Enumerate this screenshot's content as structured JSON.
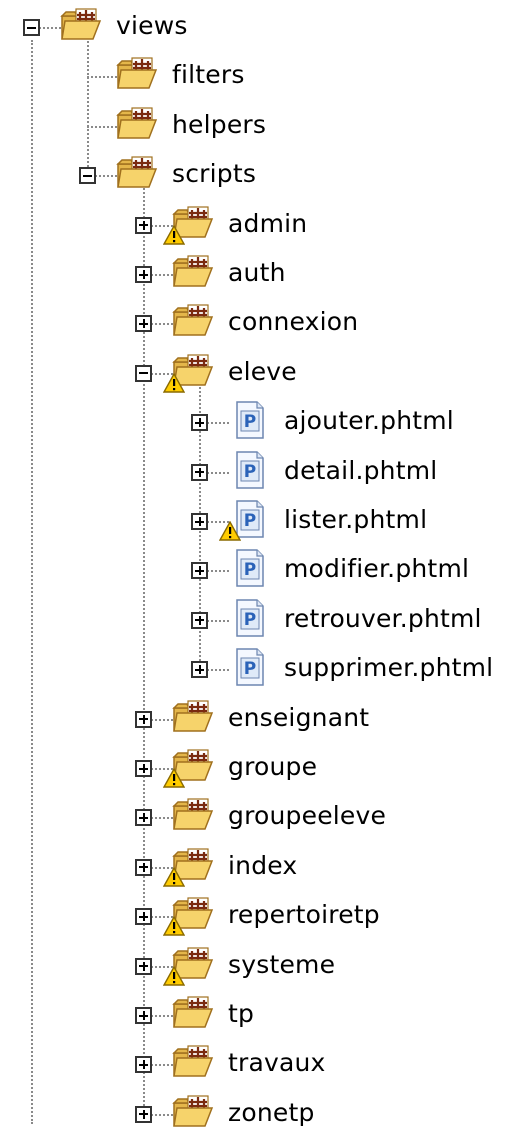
{
  "tree": {
    "nodes": [
      {
        "id": "views",
        "label": "views",
        "level": 0,
        "expanded": true,
        "expander": true,
        "icon": "folder-open-icon",
        "warning": false
      },
      {
        "id": "filters",
        "label": "filters",
        "level": 1,
        "expander": false,
        "icon": "folder-open-icon",
        "warning": false
      },
      {
        "id": "helpers",
        "label": "helpers",
        "level": 1,
        "expander": false,
        "icon": "folder-open-icon",
        "warning": false
      },
      {
        "id": "scripts",
        "label": "scripts",
        "level": 1,
        "expanded": true,
        "expander": true,
        "icon": "folder-open-icon",
        "warning": false
      },
      {
        "id": "admin",
        "label": "admin",
        "level": 2,
        "expanded": false,
        "expander": true,
        "icon": "folder-open-icon",
        "warning": true
      },
      {
        "id": "auth",
        "label": "auth",
        "level": 2,
        "expanded": false,
        "expander": true,
        "icon": "folder-open-icon",
        "warning": false
      },
      {
        "id": "connexion",
        "label": "connexion",
        "level": 2,
        "expanded": false,
        "expander": true,
        "icon": "folder-open-icon",
        "warning": false
      },
      {
        "id": "eleve",
        "label": "eleve",
        "level": 2,
        "expanded": true,
        "expander": true,
        "icon": "folder-open-icon",
        "warning": true
      },
      {
        "id": "ajouter",
        "label": "ajouter.phtml",
        "level": 3,
        "expanded": false,
        "expander": true,
        "icon": "php-file-icon",
        "warning": false
      },
      {
        "id": "detail",
        "label": "detail.phtml",
        "level": 3,
        "expanded": false,
        "expander": true,
        "icon": "php-file-icon",
        "warning": false
      },
      {
        "id": "lister",
        "label": "lister.phtml",
        "level": 3,
        "expanded": false,
        "expander": true,
        "icon": "php-file-icon",
        "warning": true
      },
      {
        "id": "modifier",
        "label": "modifier.phtml",
        "level": 3,
        "expanded": false,
        "expander": true,
        "icon": "php-file-icon",
        "warning": false
      },
      {
        "id": "retrouver",
        "label": "retrouver.phtml",
        "level": 3,
        "expanded": false,
        "expander": true,
        "icon": "php-file-icon",
        "warning": false
      },
      {
        "id": "supprimer",
        "label": "supprimer.phtml",
        "level": 3,
        "expanded": false,
        "expander": true,
        "icon": "php-file-icon",
        "warning": false
      },
      {
        "id": "enseignant",
        "label": "enseignant",
        "level": 2,
        "expanded": false,
        "expander": true,
        "icon": "folder-open-icon",
        "warning": false
      },
      {
        "id": "groupe",
        "label": "groupe",
        "level": 2,
        "expanded": false,
        "expander": true,
        "icon": "folder-open-icon",
        "warning": true
      },
      {
        "id": "groupeeleve",
        "label": "groupeeleve",
        "level": 2,
        "expanded": false,
        "expander": true,
        "icon": "folder-open-icon",
        "warning": false
      },
      {
        "id": "index",
        "label": "index",
        "level": 2,
        "expanded": false,
        "expander": true,
        "icon": "folder-open-icon",
        "warning": true
      },
      {
        "id": "repertoiretp",
        "label": "repertoiretp",
        "level": 2,
        "expanded": false,
        "expander": true,
        "icon": "folder-open-icon",
        "warning": true
      },
      {
        "id": "systeme",
        "label": "systeme",
        "level": 2,
        "expanded": false,
        "expander": true,
        "icon": "folder-open-icon",
        "warning": true
      },
      {
        "id": "tp",
        "label": "tp",
        "level": 2,
        "expanded": false,
        "expander": true,
        "icon": "folder-open-icon",
        "warning": false
      },
      {
        "id": "travaux",
        "label": "travaux",
        "level": 2,
        "expanded": false,
        "expander": true,
        "icon": "folder-open-icon",
        "warning": false
      },
      {
        "id": "zonetp",
        "label": "zonetp",
        "level": 2,
        "expanded": false,
        "expander": true,
        "icon": "folder-open-icon",
        "warning": false
      }
    ]
  },
  "colors": {
    "folder_fill": "#f6d36b",
    "folder_edge": "#a0701e",
    "warning_fill": "#ffcc00",
    "php_badge": "#2b63b8",
    "tree_line": "#8a8a8a"
  }
}
